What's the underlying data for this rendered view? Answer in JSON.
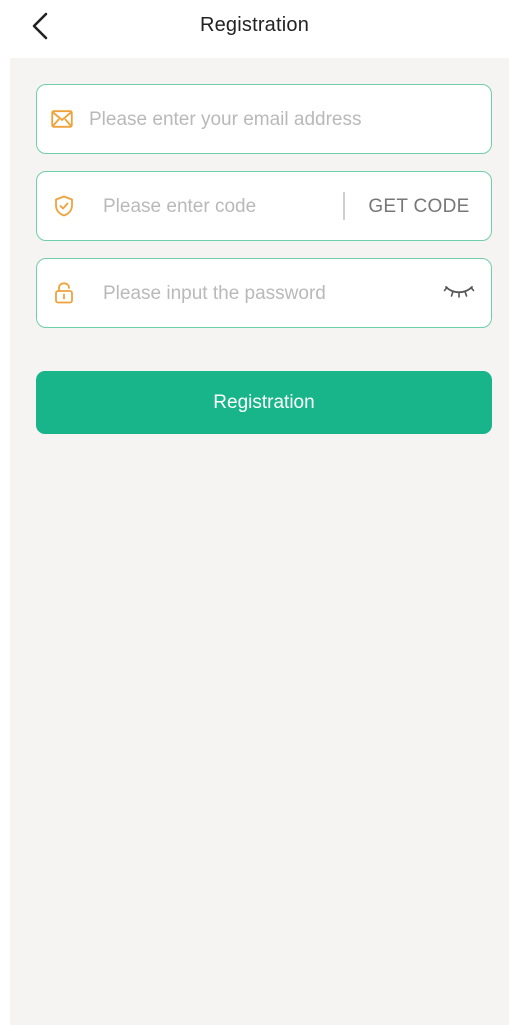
{
  "header": {
    "title": "Registration",
    "back_icon": "chevron-left-icon"
  },
  "form": {
    "email": {
      "placeholder": "Please enter your email address",
      "value": "",
      "icon": "mail-icon"
    },
    "code": {
      "placeholder": "Please enter code",
      "value": "",
      "icon": "shield-check-icon",
      "get_code_label": "GET CODE"
    },
    "password": {
      "placeholder": "Please input the password",
      "value": "",
      "icon": "lock-icon",
      "toggle_icon": "eye-closed-icon"
    },
    "submit_label": "Registration"
  },
  "colors": {
    "accent": "#18b58b",
    "field_border": "#6fcfa9",
    "icon_orange": "#f0a23a",
    "background": "#f5f4f2"
  }
}
